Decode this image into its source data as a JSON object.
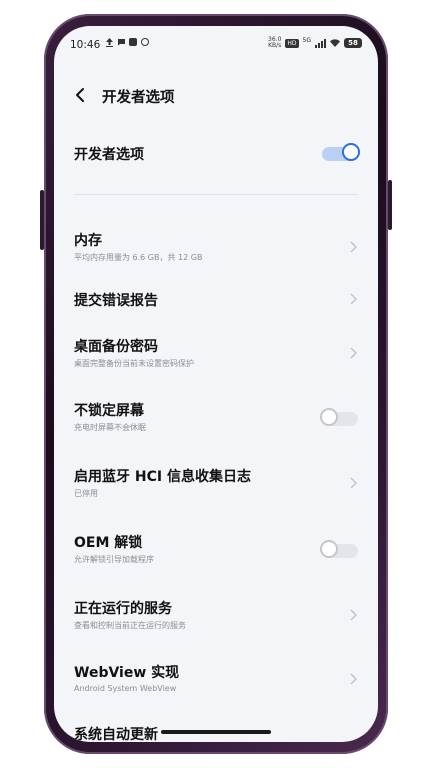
{
  "status_bar": {
    "time": "10:46",
    "net_speed_value": "36.0",
    "net_speed_unit": "KB/s",
    "hd_label": "HD",
    "network_type": "5G",
    "battery_level": "58"
  },
  "header": {
    "title": "开发者选项"
  },
  "dev_options_toggle": {
    "label": "开发者选项",
    "enabled": true
  },
  "items": [
    {
      "title": "内存",
      "subtitle": "平均内存用量为 6.6 GB，共 12 GB",
      "control": "chevron"
    },
    {
      "title": "提交错误报告",
      "subtitle": "",
      "control": "chevron"
    },
    {
      "title": "桌面备份密码",
      "subtitle": "桌面完整备份当前未设置密码保护",
      "control": "chevron"
    },
    {
      "title": "不锁定屏幕",
      "subtitle": "充电时屏幕不会休眠",
      "control": "toggle",
      "enabled": false
    },
    {
      "title": "启用蓝牙 HCI 信息收集日志",
      "subtitle": "已停用",
      "control": "chevron"
    },
    {
      "title": "OEM 解锁",
      "subtitle": "允许解锁引导加载程序",
      "control": "toggle",
      "enabled": false
    },
    {
      "title": "正在运行的服务",
      "subtitle": "查看和控制当前正在运行的服务",
      "control": "chevron"
    },
    {
      "title": "WebView 实现",
      "subtitle": "Android System WebView",
      "control": "chevron"
    },
    {
      "title": "系统自动更新",
      "subtitle": "",
      "control": "chevron"
    }
  ],
  "colors": {
    "accent": "#2b6fe0",
    "background": "#f4f5f9",
    "subtitle": "#8a8d94"
  }
}
